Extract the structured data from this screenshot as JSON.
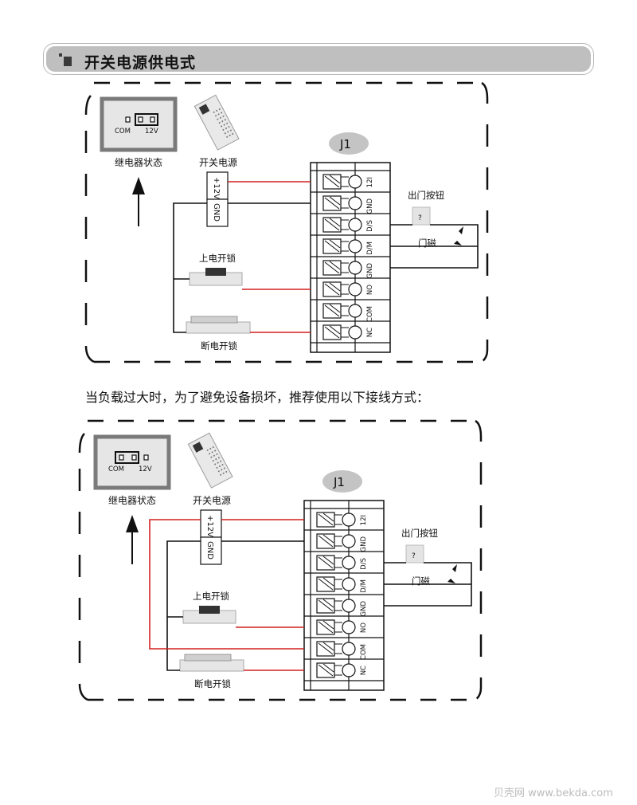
{
  "section": {
    "title": "开关电源供电式",
    "icon": "section-square-icon"
  },
  "note": "当负载过大时，为了避免设备损坏，推荐使用以下接线方式：",
  "diagrams": [
    {
      "id": "diagram-1",
      "relay_state": {
        "caption": "继电器状态",
        "pins": [
          "COM",
          "12V"
        ],
        "jumper": "12V"
      },
      "power_supply": {
        "caption": "开关电源",
        "terminals": [
          "+12V",
          "GND"
        ]
      },
      "connector": {
        "label": "J1",
        "terminals": [
          "12I",
          "GND",
          "D/S",
          "D/M",
          "GND",
          "NO",
          "COM",
          "NC"
        ]
      },
      "exit_button": "出门按钮",
      "door_sensor": "门磁",
      "lock_power_on": "上电开锁",
      "lock_power_off": "断电开锁"
    },
    {
      "id": "diagram-2",
      "relay_state": {
        "caption": "继电器状态",
        "pins": [
          "COM",
          "12V"
        ],
        "jumper": "COM"
      },
      "power_supply": {
        "caption": "开关电源",
        "terminals": [
          "+12V",
          "GND"
        ]
      },
      "connector": {
        "label": "J1",
        "terminals": [
          "12I",
          "GND",
          "D/S",
          "D/M",
          "GND",
          "NO",
          "COM",
          "NC"
        ]
      },
      "exit_button": "出门按钮",
      "door_sensor": "门磁",
      "lock_power_on": "上电开锁",
      "lock_power_off": "断电开锁"
    }
  ],
  "colors": {
    "wire_red": "#d42020",
    "wire_black": "#111111",
    "header_bg": "#bfbfbf",
    "badge_bg": "#c4c4c4"
  },
  "watermark": "贝壳网 www.bekda.com"
}
